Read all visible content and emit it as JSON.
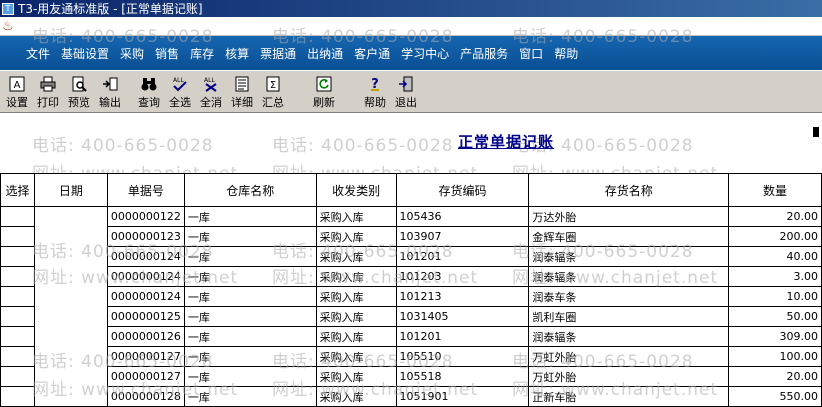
{
  "window": {
    "title": "T3-用友通标准版 - [正常单据记账]"
  },
  "menu": [
    "文件",
    "基础设置",
    "采购",
    "销售",
    "库存",
    "核算",
    "票据通",
    "出纳通",
    "客户通",
    "学习中心",
    "产品服务",
    "窗口",
    "帮助"
  ],
  "toolbar": {
    "settings": "设置",
    "print": "打印",
    "preview": "预览",
    "export": "输出",
    "query": "查询",
    "select_all": "全选",
    "deselect_all": "全消",
    "detail": "详细",
    "summary": "汇总",
    "refresh": "刷新",
    "help": "帮助",
    "exit": "退出"
  },
  "report": {
    "title": "正常单据记账"
  },
  "table": {
    "columns": [
      "选择",
      "日期",
      "单据号",
      "仓库名称",
      "收发类别",
      "存货编码",
      "存货名称",
      "数量"
    ],
    "rows": [
      [
        "",
        "",
        "0000000122",
        "一库",
        "采购入库",
        "105436",
        "万达外胎",
        "20.00"
      ],
      [
        "",
        "",
        "0000000123",
        "一库",
        "采购入库",
        "103907",
        "金辉车圈",
        "200.00"
      ],
      [
        "",
        "",
        "0000000124",
        "一库",
        "采购入库",
        "101201",
        "润泰辐条",
        "40.00"
      ],
      [
        "",
        "",
        "0000000124",
        "一库",
        "采购入库",
        "101203",
        "润泰辐条",
        "3.00"
      ],
      [
        "",
        "",
        "0000000124",
        "一库",
        "采购入库",
        "101213",
        "润泰车条",
        "10.00"
      ],
      [
        "",
        "",
        "0000000125",
        "一库",
        "采购入库",
        "1031405",
        "凯利车圈",
        "50.00"
      ],
      [
        "",
        "",
        "0000000126",
        "一库",
        "采购入库",
        "101201",
        "润泰辐条",
        "309.00"
      ],
      [
        "",
        "",
        "0000000127",
        "一库",
        "采购入库",
        "105510",
        "万虹外胎",
        "100.00"
      ],
      [
        "",
        "",
        "0000000127",
        "一库",
        "采购入库",
        "105518",
        "万虹外胎",
        "20.00"
      ],
      [
        "",
        "",
        "0000000128",
        "一库",
        "采购入库",
        "1051901",
        "正新车胎",
        "550.00"
      ]
    ]
  },
  "watermark": {
    "phone": "电话: 400-665-0028",
    "site": "网址: www.chanjet.net"
  },
  "colors": {
    "title_bar": "#0a246a",
    "menu_bar": "#1566b0",
    "toolbar": "#d4d0c8",
    "report_title": "#00008b"
  },
  "icons": {
    "settings": "settings-icon",
    "print": "printer-icon",
    "preview": "preview-icon",
    "export": "export-icon",
    "query": "binoculars-icon",
    "select_all": "select-all-icon",
    "deselect_all": "deselect-all-icon",
    "detail": "detail-icon",
    "summary": "summary-icon",
    "refresh": "refresh-icon",
    "help": "help-icon",
    "exit": "exit-icon"
  }
}
